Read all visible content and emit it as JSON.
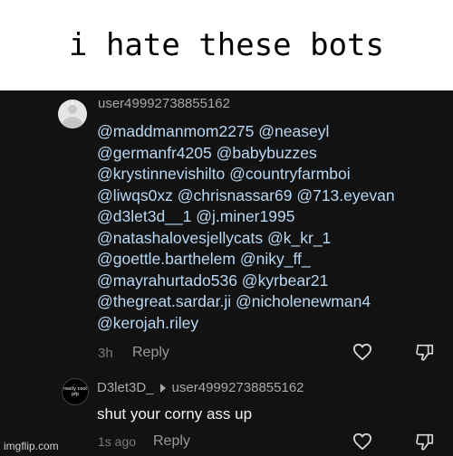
{
  "caption": "i hate these bots",
  "comment1": {
    "username": "user49992738855162",
    "mentions": [
      "@maddmanmom2275 @neaseyl",
      "@germanfr4205 @babybuzzes",
      "@krystinnevishilto @countryfarmboi",
      "@liwqs0xz @chrisnassar69 @713.eyevan",
      "@d3let3d__1 @j.miner1995",
      "@natashalovesjellycats @k_kr_1",
      "@goettle.barthelem @niky_ff_",
      "@mayrahurtado536 @kyrbear21",
      "@thegreat.sardar.ji @nicholenewman4",
      "@kerojah.riley"
    ],
    "time": "3h",
    "reply_label": "Reply",
    "icons": {
      "like": "heart-outline-icon",
      "dislike": "thumbs-down-outline-icon"
    }
  },
  "comment2": {
    "avatar_text": "really cool pfp",
    "username": "D3let3D_",
    "reply_to": "user49992738855162",
    "text": "shut your corny ass up",
    "time": "1s ago",
    "reply_label": "Reply",
    "icons": {
      "like": "heart-outline-icon",
      "dislike": "thumbs-down-outline-icon",
      "arrow": "reply-arrow-icon"
    }
  },
  "watermark": "imgflip.com",
  "colors": {
    "background": "#121212",
    "mention": "#b8d8f4",
    "muted": "#a8a8a8"
  }
}
